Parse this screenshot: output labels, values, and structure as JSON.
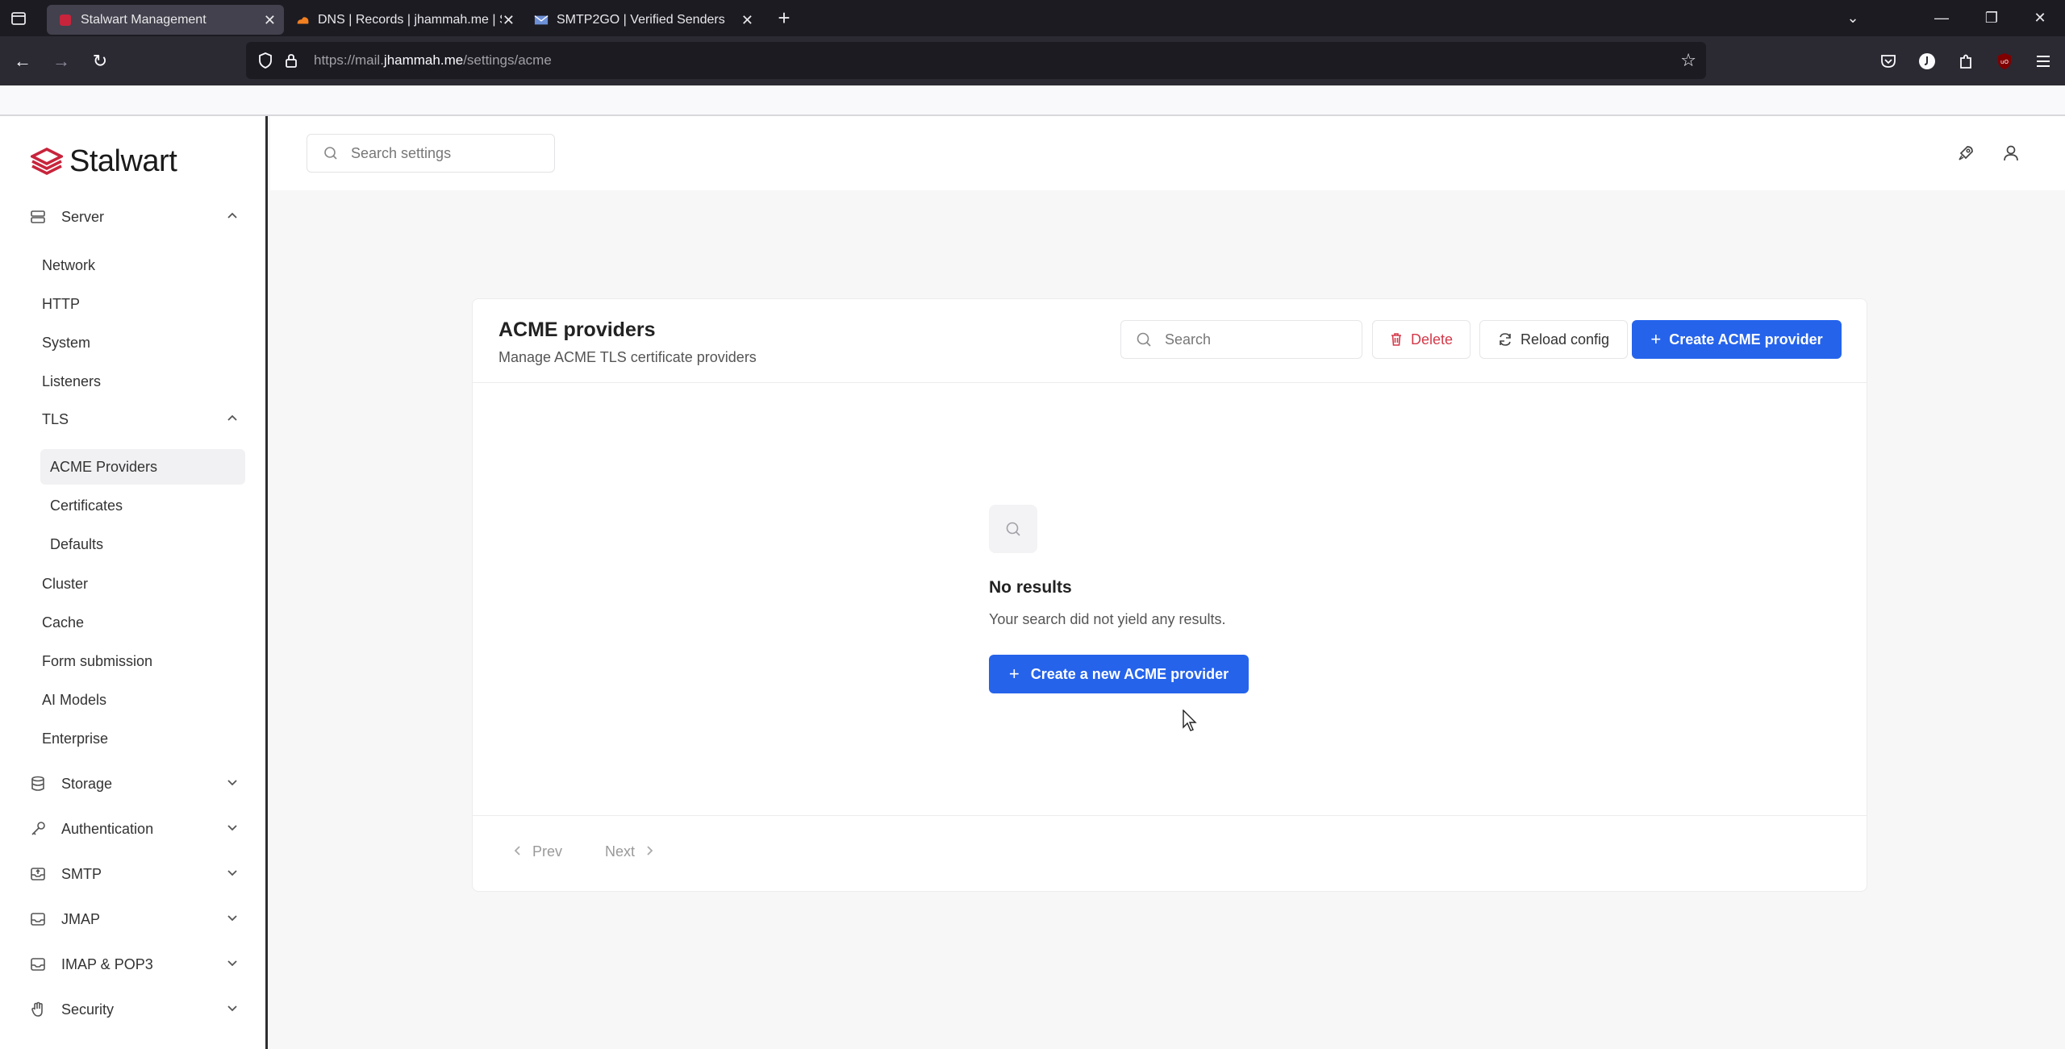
{
  "browser": {
    "tabs": [
      {
        "title": "Stalwart Management",
        "favicon": "stalwart-favicon",
        "active": true
      },
      {
        "title": "DNS | Records | jhammah.me | S",
        "favicon": "cloudflare-favicon",
        "active": false
      },
      {
        "title": "SMTP2GO | Verified Senders",
        "favicon": "mail-favicon",
        "active": false
      }
    ],
    "url_prefix": "https://mail.",
    "url_domain": "jhammah.me",
    "url_path": "/settings/acme"
  },
  "app": {
    "brand": "Stalwart",
    "brand_color": "#c8243c",
    "search_placeholder": "Search settings",
    "sidebar": {
      "server_label": "Server",
      "server_items": [
        "Network",
        "HTTP",
        "System",
        "Listeners"
      ],
      "tls_label": "TLS",
      "tls_items": [
        "ACME Providers",
        "Certificates",
        "Defaults"
      ],
      "more_items": [
        "Cluster",
        "Cache",
        "Form submission",
        "AI Models",
        "Enterprise"
      ],
      "groups": [
        "Storage",
        "Authentication",
        "SMTP",
        "JMAP",
        "IMAP & POP3",
        "Security"
      ]
    },
    "page": {
      "title": "ACME providers",
      "subtitle": "Manage ACME TLS certificate providers",
      "search_placeholder": "Search",
      "delete_label": "Delete",
      "reload_label": "Reload config",
      "create_label": "Create ACME provider",
      "empty_title": "No results",
      "empty_text": "Your search did not yield any results.",
      "empty_button": "Create a new ACME provider",
      "prev_label": "Prev",
      "next_label": "Next"
    },
    "accent_color": "#2563eb"
  }
}
